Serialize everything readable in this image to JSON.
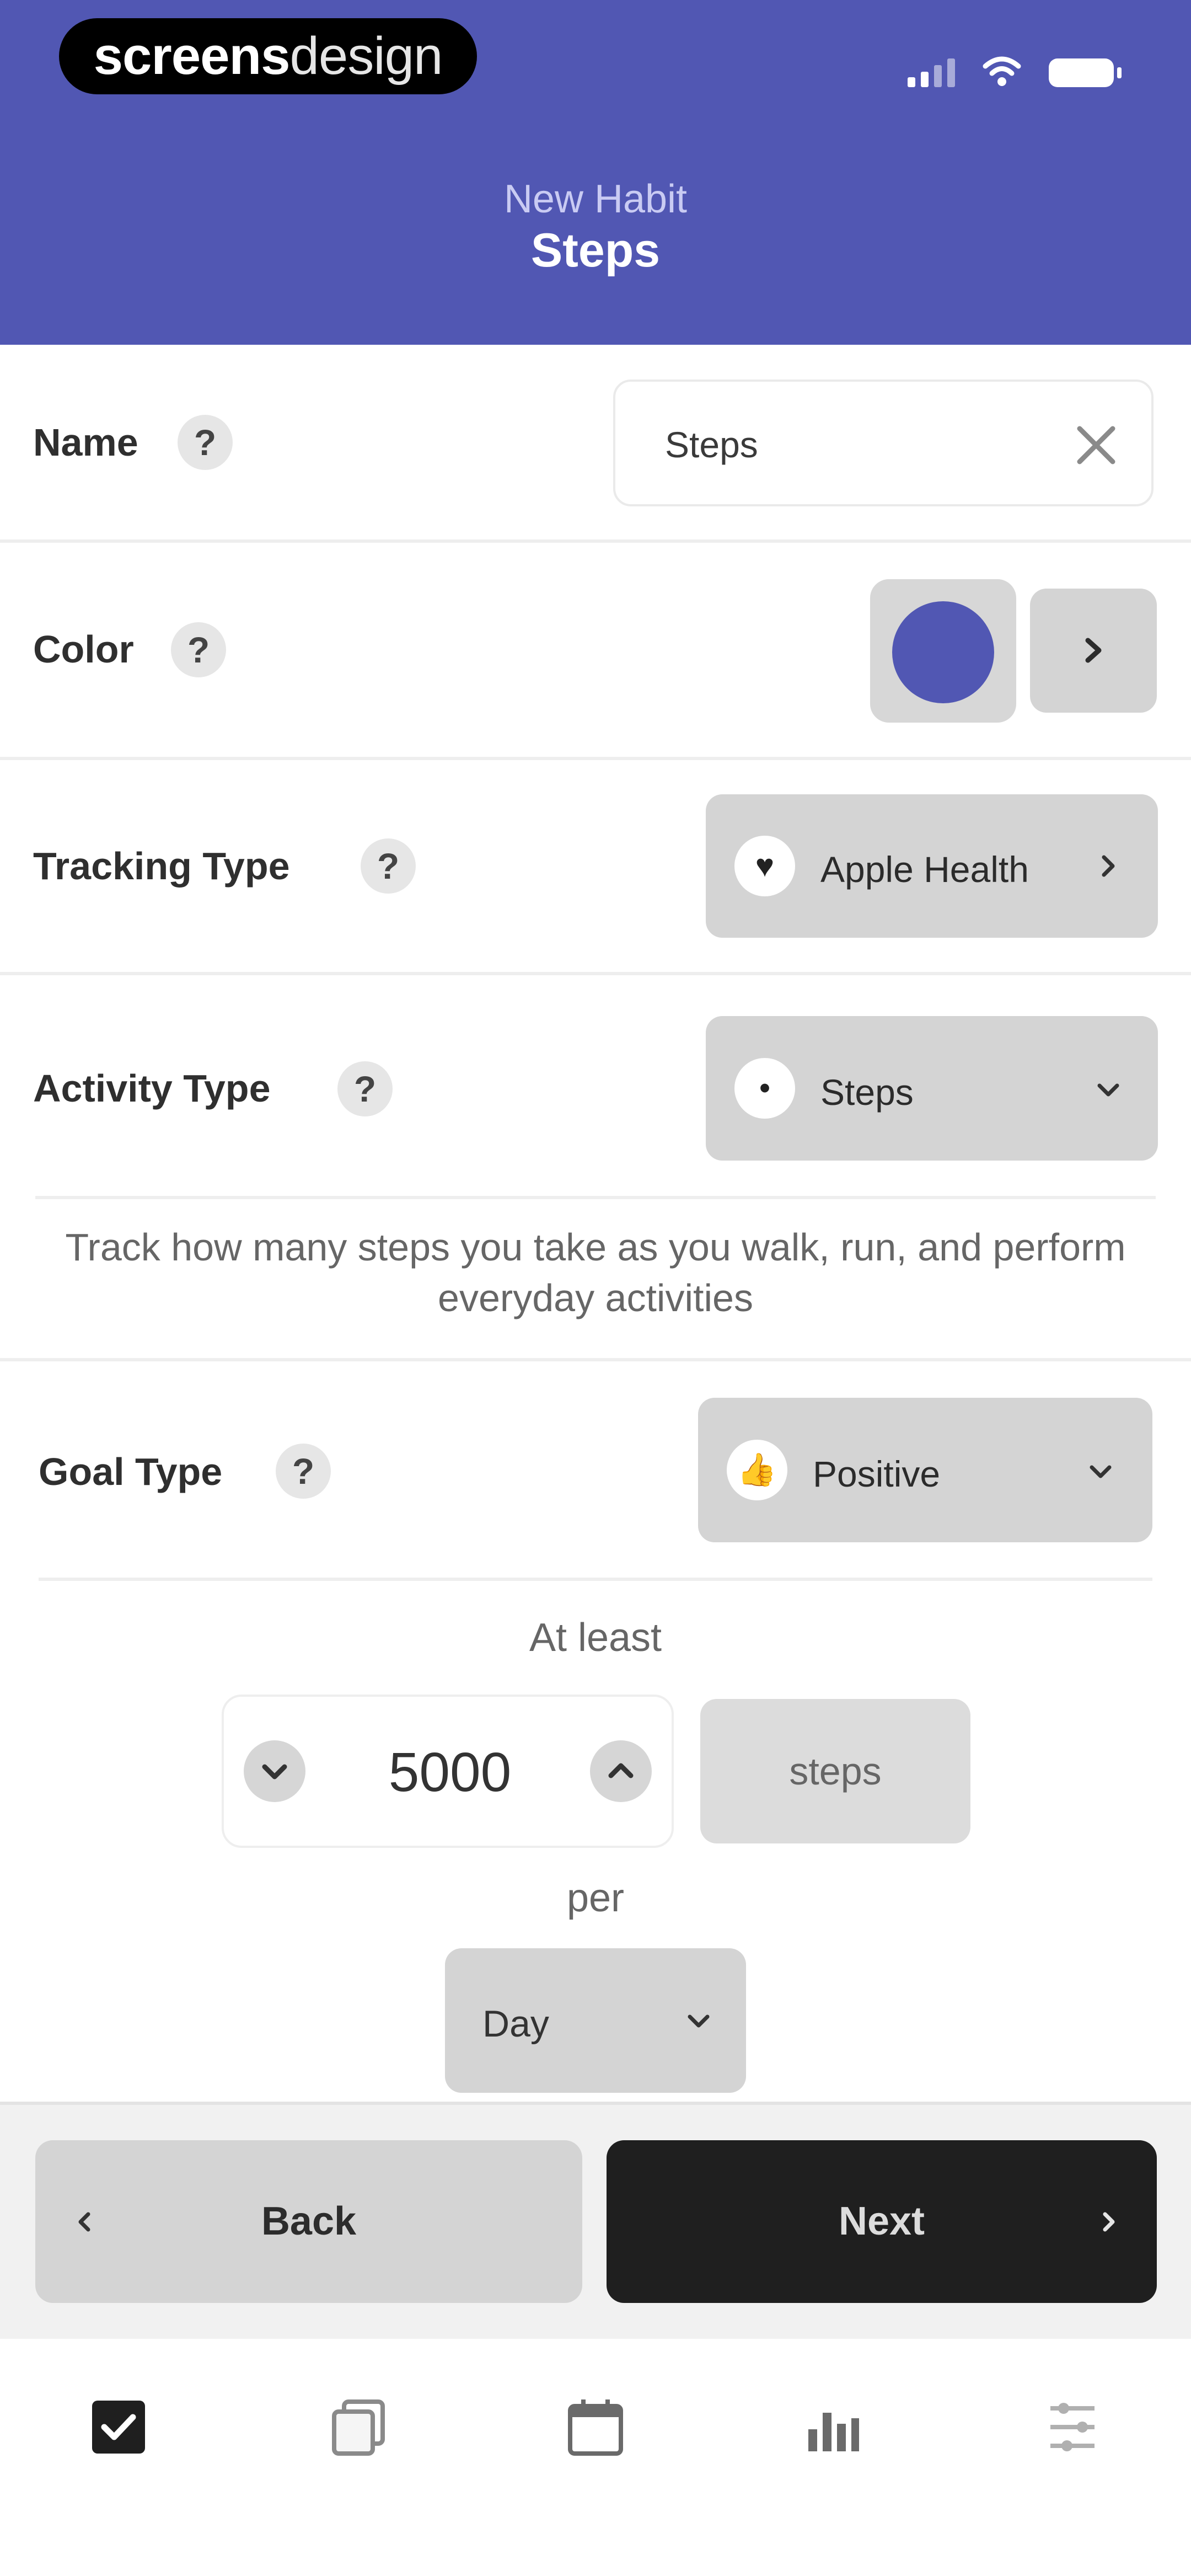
{
  "status_bar": {
    "brand_bold": "screens",
    "brand_light": "design"
  },
  "header": {
    "subtitle": "New Habit",
    "title": "Steps"
  },
  "form": {
    "name": {
      "label": "Name",
      "value": "Steps"
    },
    "color": {
      "label": "Color",
      "value": "#5157b3"
    },
    "tracking_type": {
      "label": "Tracking Type",
      "value": "Apple Health"
    },
    "activity_type": {
      "label": "Activity Type",
      "value": "Steps",
      "description": "Track how many steps you take as you walk, run, and perform everyday activities"
    },
    "goal_type": {
      "label": "Goal Type",
      "value": "Positive"
    },
    "goal": {
      "qualifier": "At least",
      "amount": "5000",
      "unit": "steps",
      "per_label": "per",
      "period": "Day"
    }
  },
  "buttons": {
    "back": "Back",
    "next": "Next"
  },
  "tabbar": {
    "items": [
      "habits-icon",
      "journal-icon",
      "calendar-icon",
      "stats-icon",
      "settings-icon"
    ],
    "active_index": 0
  },
  "colors": {
    "accent": "#5157b3",
    "primary_button": "#1f1f1f",
    "secondary_button": "#d4d4d4"
  }
}
